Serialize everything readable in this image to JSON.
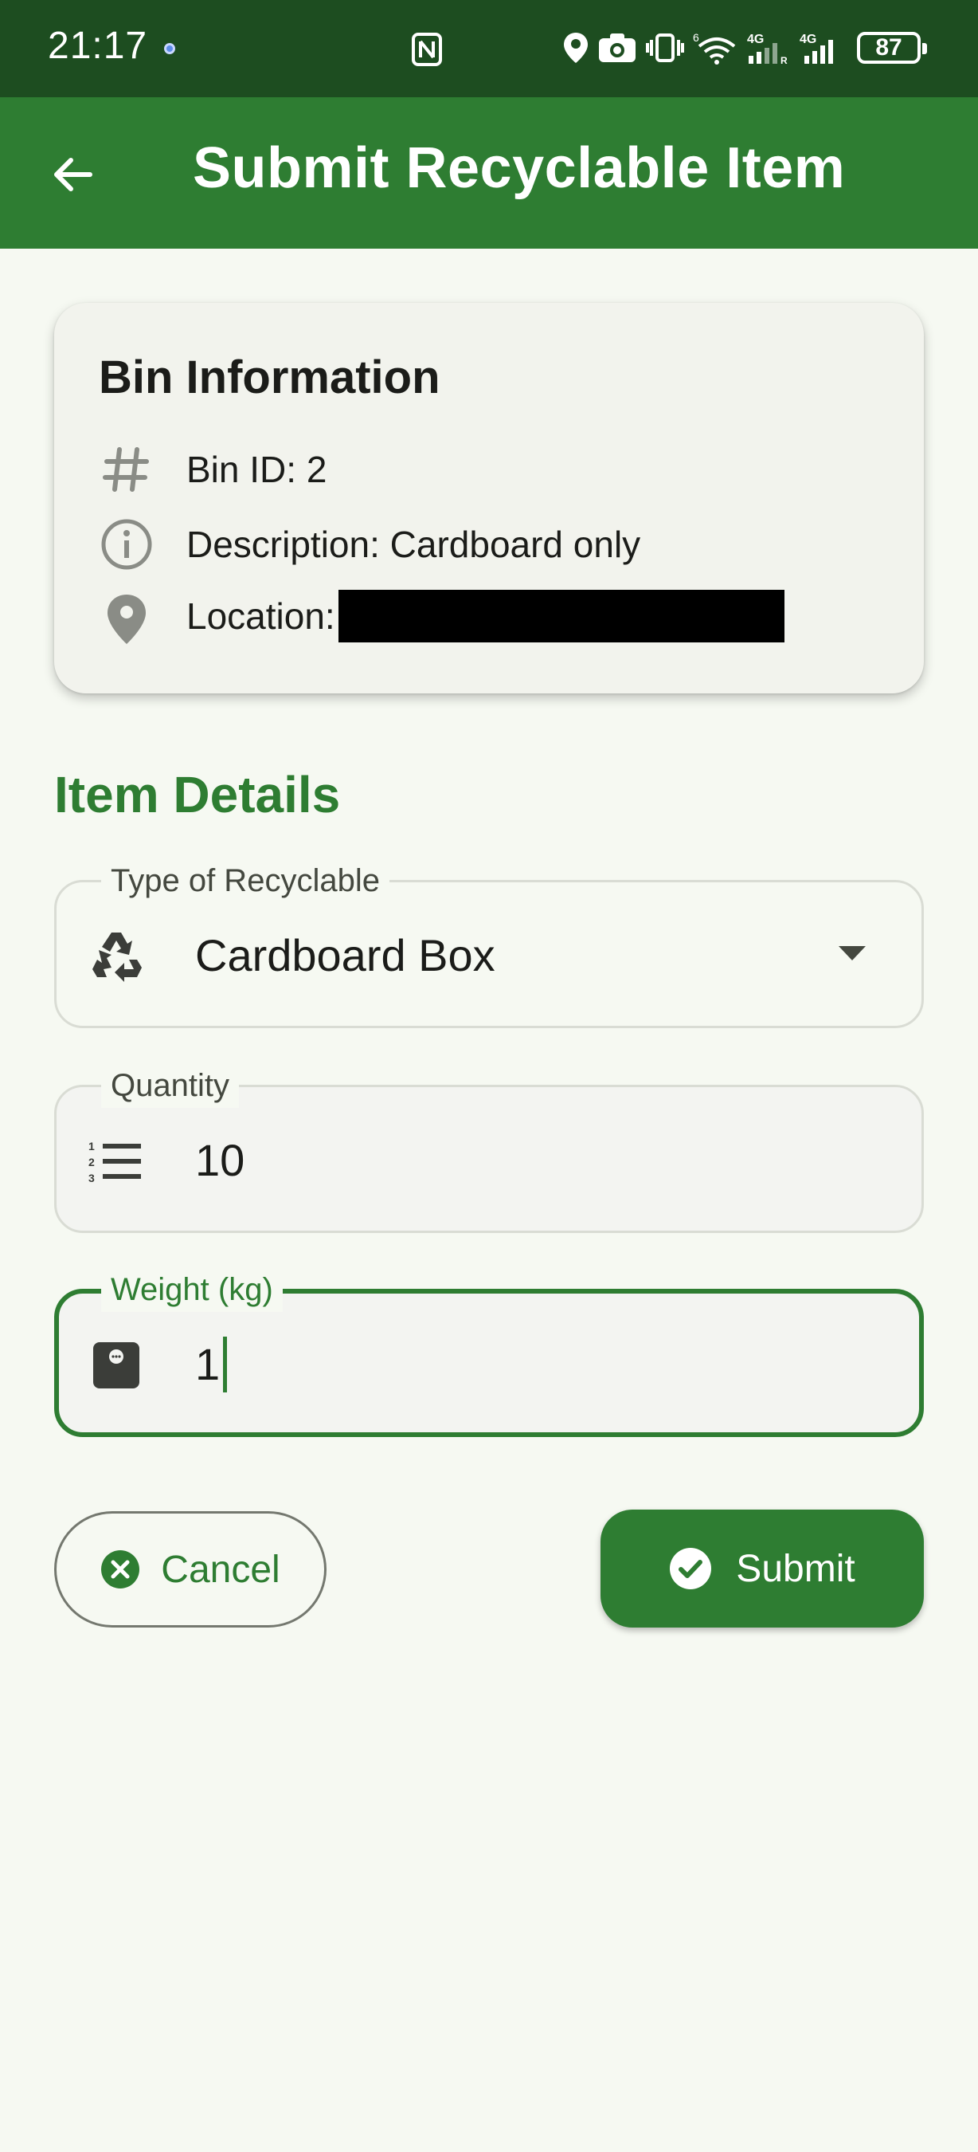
{
  "status_bar": {
    "time": "21:17",
    "battery": "87",
    "network_1": "4G",
    "network_2": "4G",
    "wifi_badge": "6"
  },
  "app_bar": {
    "title": "Submit Recyclable Item",
    "back_icon": "arrow-back-icon"
  },
  "bin_info": {
    "title": "Bin Information",
    "bin_id": "Bin ID: 2",
    "description": "Description: Cardboard only",
    "location_label": "Location:"
  },
  "item_details": {
    "title": "Item Details",
    "type_field": {
      "label": "Type of Recyclable",
      "value": "Cardboard Box",
      "icon": "recycle-icon"
    },
    "quantity_field": {
      "label": "Quantity",
      "value": "10",
      "icon": "numbered-list-icon"
    },
    "weight_field": {
      "label": "Weight (kg)",
      "value": "1",
      "icon": "scale-icon"
    }
  },
  "actions": {
    "cancel_label": "Cancel",
    "submit_label": "Submit"
  },
  "colors": {
    "primary": "#2e7d32",
    "status_bar": "#1d4d20",
    "background": "#f6f9f2"
  }
}
